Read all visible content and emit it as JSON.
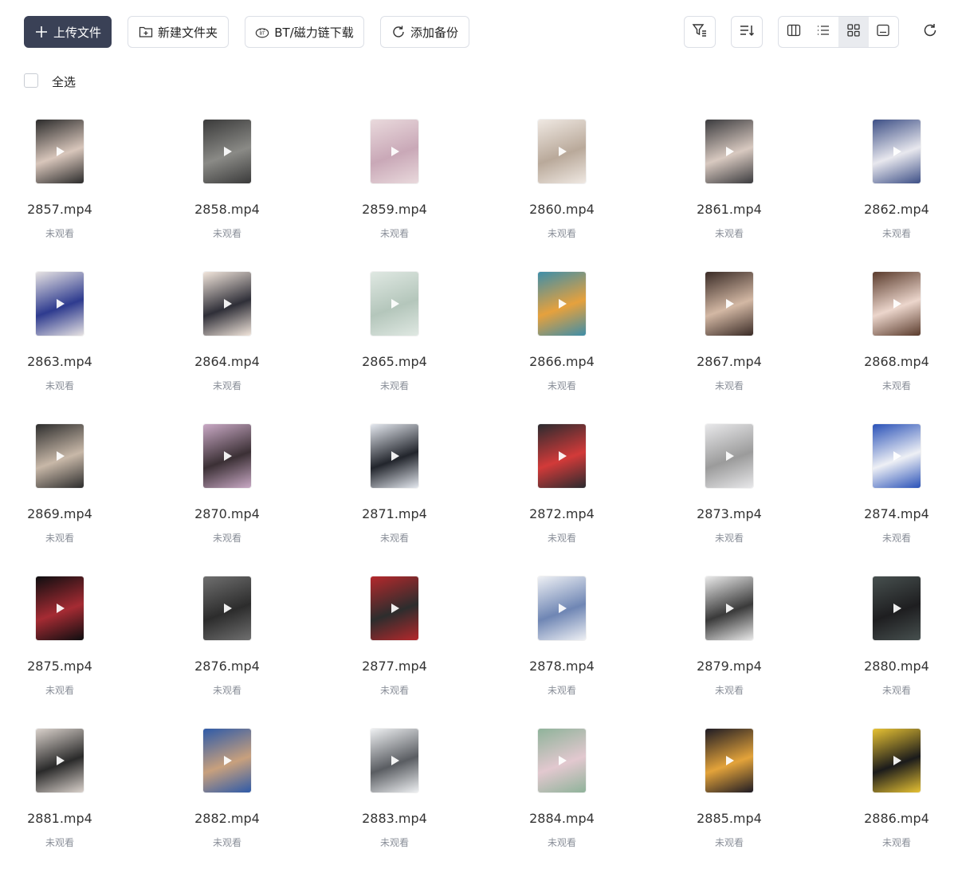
{
  "toolbar": {
    "upload_label": "上传文件",
    "new_folder_label": "新建文件夹",
    "bt_label": "BT/磁力链下载",
    "backup_label": "添加备份"
  },
  "select_all_label": "全选",
  "files": [
    {
      "name": "2857.mp4",
      "status": "未观看",
      "c1": "#2b2b2b",
      "c2": "#d8c6bb"
    },
    {
      "name": "2858.mp4",
      "status": "未观看",
      "c1": "#3a3a3a",
      "c2": "#8a8a86"
    },
    {
      "name": "2859.mp4",
      "status": "未观看",
      "c1": "#e9d9dc",
      "c2": "#c9a8b7"
    },
    {
      "name": "2860.mp4",
      "status": "未观看",
      "c1": "#efe8e2",
      "c2": "#b9a99a"
    },
    {
      "name": "2861.mp4",
      "status": "未观看",
      "c1": "#3b3b3e",
      "c2": "#d8c9c0"
    },
    {
      "name": "2862.mp4",
      "status": "未观看",
      "c1": "#3d4f86",
      "c2": "#e8e8ee"
    },
    {
      "name": "2863.mp4",
      "status": "未观看",
      "c1": "#e7e3e3",
      "c2": "#2e3b8f"
    },
    {
      "name": "2864.mp4",
      "status": "未观看",
      "c1": "#f2e6dc",
      "c2": "#2f2f38"
    },
    {
      "name": "2865.mp4",
      "status": "未观看",
      "c1": "#dfe8e2",
      "c2": "#b4c6bb"
    },
    {
      "name": "2866.mp4",
      "status": "未观看",
      "c1": "#3e8ea9",
      "c2": "#e6a13d"
    },
    {
      "name": "2867.mp4",
      "status": "未观看",
      "c1": "#3a2b26",
      "c2": "#d3b8a4"
    },
    {
      "name": "2868.mp4",
      "status": "未观看",
      "c1": "#5a3b2c",
      "c2": "#ecd6cc"
    },
    {
      "name": "2869.mp4",
      "status": "未观看",
      "c1": "#2d2d2d",
      "c2": "#c8b8a8"
    },
    {
      "name": "2870.mp4",
      "status": "未观看",
      "c1": "#c9a9c5",
      "c2": "#3b3035"
    },
    {
      "name": "2871.mp4",
      "status": "未观看",
      "c1": "#e4e8ef",
      "c2": "#22252c"
    },
    {
      "name": "2872.mp4",
      "status": "未观看",
      "c1": "#2b2b2f",
      "c2": "#d23a39"
    },
    {
      "name": "2873.mp4",
      "status": "未观看",
      "c1": "#e8e8ea",
      "c2": "#9b9b9b"
    },
    {
      "name": "2874.mp4",
      "status": "未观看",
      "c1": "#2a52b8",
      "c2": "#eef0f5"
    },
    {
      "name": "2875.mp4",
      "status": "未观看",
      "c1": "#0e0e10",
      "c2": "#a52b33"
    },
    {
      "name": "2876.mp4",
      "status": "未观看",
      "c1": "#6f6f6f",
      "c2": "#2c2c2c"
    },
    {
      "name": "2877.mp4",
      "status": "未观看",
      "c1": "#b5282c",
      "c2": "#2d2d2d"
    },
    {
      "name": "2878.mp4",
      "status": "未观看",
      "c1": "#eef0f4",
      "c2": "#6f86b4"
    },
    {
      "name": "2879.mp4",
      "status": "未观看",
      "c1": "#eaeaea",
      "c2": "#3a3a3a"
    },
    {
      "name": "2880.mp4",
      "status": "未观看",
      "c1": "#47504f",
      "c2": "#1e1e20"
    },
    {
      "name": "2881.mp4",
      "status": "未观看",
      "c1": "#dad2cc",
      "c2": "#2a2a2a"
    },
    {
      "name": "2882.mp4",
      "status": "未观看",
      "c1": "#2e5aa8",
      "c2": "#c8a07d"
    },
    {
      "name": "2883.mp4",
      "status": "未观看",
      "c1": "#eef0f2",
      "c2": "#5a5d62"
    },
    {
      "name": "2884.mp4",
      "status": "未观看",
      "c1": "#8fb39a",
      "c2": "#e2c8cf"
    },
    {
      "name": "2885.mp4",
      "status": "未观看",
      "c1": "#1e1b24",
      "c2": "#e3a33a"
    },
    {
      "name": "2886.mp4",
      "status": "未观看",
      "c1": "#e7c233",
      "c2": "#1b1b1b"
    }
  ]
}
